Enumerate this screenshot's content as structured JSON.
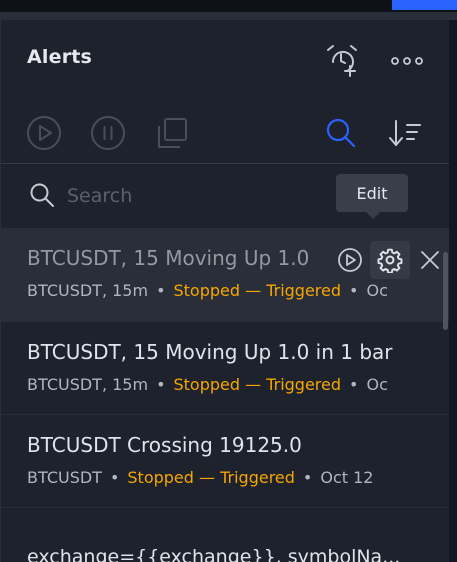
{
  "colors": {
    "background": "#131722",
    "panel": "#1e222d",
    "accent": "#2962ff",
    "status_orange": "#f7a600",
    "text_primary": "#e0e3eb",
    "text_secondary": "#b2b5be"
  },
  "header": {
    "title": "Alerts",
    "add_alert_icon": "alarm-clock-plus-icon",
    "more_icon": "more-horizontal-icon"
  },
  "toolbar": {
    "play_icon": "play-circle-icon",
    "pause_icon": "pause-circle-icon",
    "copy_icon": "copy-icon",
    "search_icon": "search-icon",
    "sort_icon": "sort-descending-icon"
  },
  "search": {
    "placeholder": "Search",
    "value": ""
  },
  "tooltip": {
    "text": "Edit"
  },
  "alerts": [
    {
      "title": "BTCUSDT, 15 Moving Up 1.0",
      "symbol_interval": "BTCUSDT, 15m",
      "status": "Stopped — Triggered",
      "date": "Oc",
      "hovered": true
    },
    {
      "title": "BTCUSDT, 15 Moving Up 1.0 in 1 bar",
      "symbol_interval": "BTCUSDT, 15m",
      "status": "Stopped — Triggered",
      "date": "Oc"
    },
    {
      "title": "BTCUSDT Crossing 19125.0",
      "symbol_interval": "BTCUSDT",
      "status": "Stopped — Triggered",
      "date": "Oct 12"
    },
    {
      "title": "exchange={{exchange}}, symbolNa..."
    }
  ]
}
